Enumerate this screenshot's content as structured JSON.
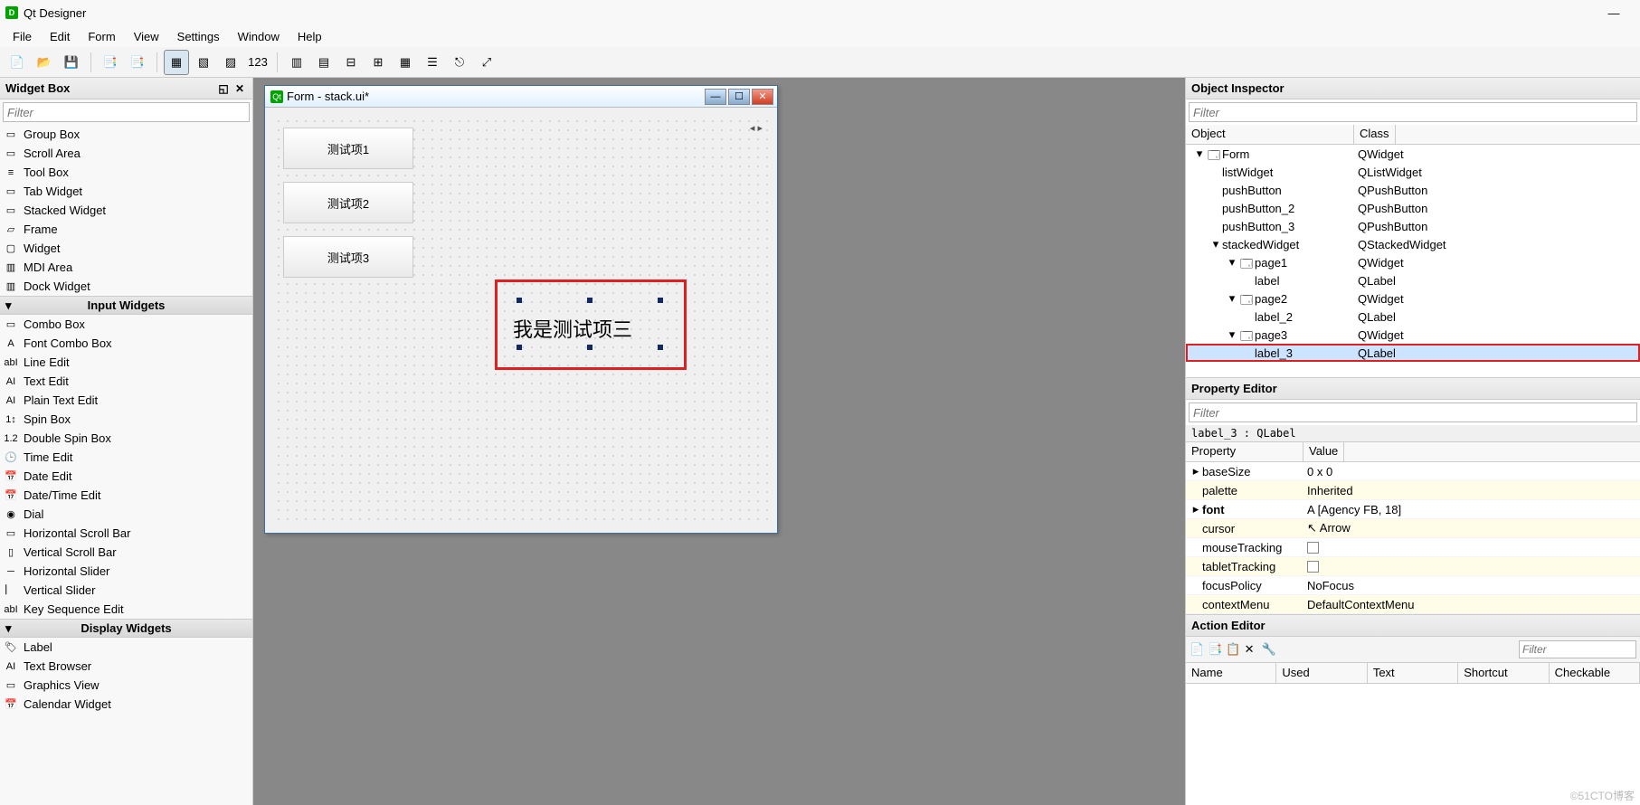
{
  "title": "Qt Designer",
  "menubar": [
    "File",
    "Edit",
    "Form",
    "View",
    "Settings",
    "Window",
    "Help"
  ],
  "widgetbox": {
    "title": "Widget Box",
    "filter_placeholder": "Filter",
    "items": [
      {
        "label": "Group Box",
        "icon": "▭"
      },
      {
        "label": "Scroll Area",
        "icon": "▭"
      },
      {
        "label": "Tool Box",
        "icon": "≡"
      },
      {
        "label": "Tab Widget",
        "icon": "▭"
      },
      {
        "label": "Stacked Widget",
        "icon": "▭"
      },
      {
        "label": "Frame",
        "icon": "▱"
      },
      {
        "label": "Widget",
        "icon": "▢"
      },
      {
        "label": "MDI Area",
        "icon": "▥"
      },
      {
        "label": "Dock Widget",
        "icon": "▥"
      }
    ],
    "cat1": "Input Widgets",
    "input_items": [
      {
        "label": "Combo Box",
        "icon": "▭"
      },
      {
        "label": "Font Combo Box",
        "icon": "A"
      },
      {
        "label": "Line Edit",
        "icon": "abI"
      },
      {
        "label": "Text Edit",
        "icon": "AI"
      },
      {
        "label": "Plain Text Edit",
        "icon": "AI"
      },
      {
        "label": "Spin Box",
        "icon": "1↕"
      },
      {
        "label": "Double Spin Box",
        "icon": "1.2"
      },
      {
        "label": "Time Edit",
        "icon": "🕒"
      },
      {
        "label": "Date Edit",
        "icon": "📅"
      },
      {
        "label": "Date/Time Edit",
        "icon": "📅"
      },
      {
        "label": "Dial",
        "icon": "◉"
      },
      {
        "label": "Horizontal Scroll Bar",
        "icon": "▭"
      },
      {
        "label": "Vertical Scroll Bar",
        "icon": "▯"
      },
      {
        "label": "Horizontal Slider",
        "icon": "─"
      },
      {
        "label": "Vertical Slider",
        "icon": "⎸"
      },
      {
        "label": "Key Sequence Edit",
        "icon": "abI"
      }
    ],
    "cat2": "Display Widgets",
    "display_items": [
      {
        "label": "Label",
        "icon": "🏷"
      },
      {
        "label": "Text Browser",
        "icon": "AI"
      },
      {
        "label": "Graphics View",
        "icon": "▭"
      },
      {
        "label": "Calendar Widget",
        "icon": "📅"
      }
    ]
  },
  "form": {
    "title": "Form - stack.ui*",
    "buttons": [
      "测试项1",
      "测试项2",
      "测试项3"
    ],
    "label_text": "我是测试项三"
  },
  "obj_inspector": {
    "title": "Object Inspector",
    "filter_placeholder": "Filter",
    "cols": [
      "Object",
      "Class"
    ],
    "rows": [
      {
        "indent": 0,
        "exp": "v",
        "icon": "form",
        "name": "Form",
        "cls": "QWidget"
      },
      {
        "indent": 1,
        "exp": "",
        "icon": "",
        "name": "listWidget",
        "cls": "QListWidget"
      },
      {
        "indent": 1,
        "exp": "",
        "icon": "",
        "name": "pushButton",
        "cls": "QPushButton"
      },
      {
        "indent": 1,
        "exp": "",
        "icon": "",
        "name": "pushButton_2",
        "cls": "QPushButton"
      },
      {
        "indent": 1,
        "exp": "",
        "icon": "",
        "name": "pushButton_3",
        "cls": "QPushButton"
      },
      {
        "indent": 1,
        "exp": "v",
        "icon": "",
        "name": "stackedWidget",
        "cls": "QStackedWidget"
      },
      {
        "indent": 2,
        "exp": "v",
        "icon": "form",
        "name": "page1",
        "cls": "QWidget"
      },
      {
        "indent": 3,
        "exp": "",
        "icon": "",
        "name": "label",
        "cls": "QLabel"
      },
      {
        "indent": 2,
        "exp": "v",
        "icon": "form",
        "name": "page2",
        "cls": "QWidget"
      },
      {
        "indent": 3,
        "exp": "",
        "icon": "",
        "name": "label_2",
        "cls": "QLabel"
      },
      {
        "indent": 2,
        "exp": "v",
        "icon": "form",
        "name": "page3",
        "cls": "QWidget"
      },
      {
        "indent": 3,
        "exp": "",
        "icon": "",
        "name": "label_3",
        "cls": "QLabel",
        "selected": true
      }
    ]
  },
  "prop_editor": {
    "title": "Property Editor",
    "filter_placeholder": "Filter",
    "selection": "label_3 : QLabel",
    "cols": [
      "Property",
      "Value"
    ],
    "rows": [
      {
        "alt": false,
        "exp": ">",
        "name": "baseSize",
        "val": "0 x 0"
      },
      {
        "alt": true,
        "exp": "",
        "name": "palette",
        "val": "Inherited"
      },
      {
        "alt": false,
        "exp": ">",
        "name": "font",
        "val": "A [Agency FB, 18]",
        "bold": true
      },
      {
        "alt": true,
        "exp": "",
        "name": "cursor",
        "val": "↖ Arrow"
      },
      {
        "alt": false,
        "exp": "",
        "name": "mouseTracking",
        "val": "",
        "checkbox": true
      },
      {
        "alt": true,
        "exp": "",
        "name": "tabletTracking",
        "val": "",
        "checkbox": true
      },
      {
        "alt": false,
        "exp": "",
        "name": "focusPolicy",
        "val": "NoFocus"
      },
      {
        "alt": true,
        "exp": "",
        "name": "contextMenu",
        "val": "DefaultContextMenu",
        "cut": true
      }
    ]
  },
  "action_editor": {
    "title": "Action Editor",
    "filter_placeholder": "Filter",
    "cols": [
      "Name",
      "Used",
      "Text",
      "Shortcut",
      "Checkable"
    ]
  },
  "watermark": "©51CTO博客"
}
